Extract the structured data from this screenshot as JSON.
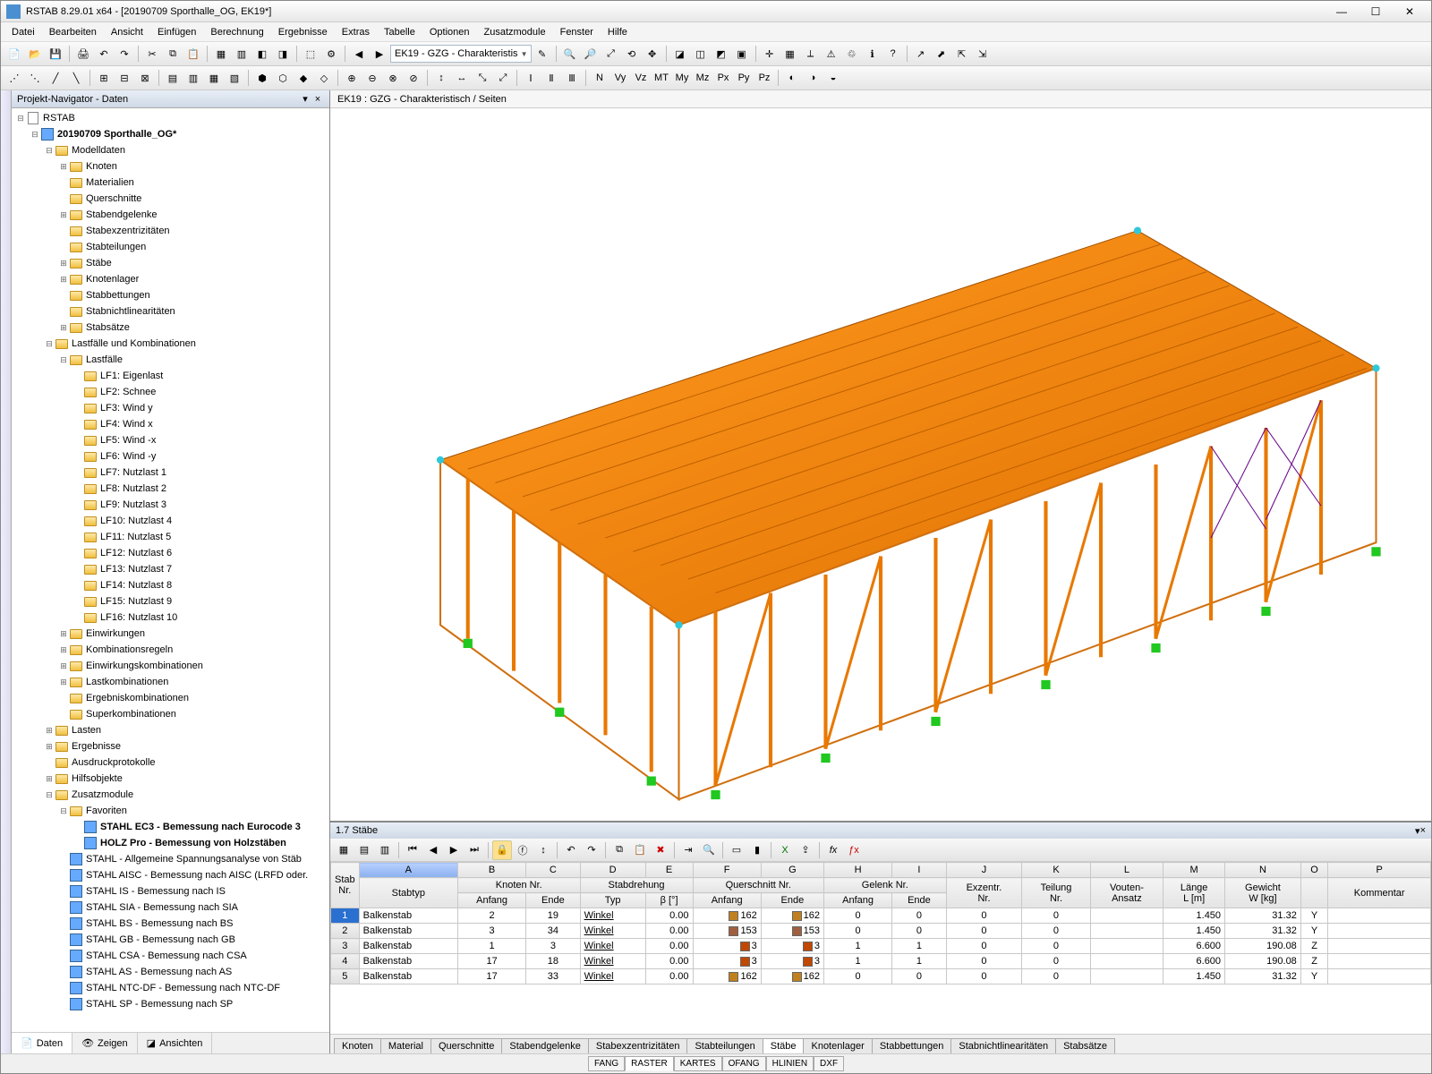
{
  "window": {
    "title": "RSTAB 8.29.01 x64 - [20190709 Sporthalle_OG, EK19*]",
    "min": "—",
    "max": "☐",
    "close": "✕"
  },
  "menu": [
    "Datei",
    "Bearbeiten",
    "Ansicht",
    "Einfügen",
    "Berechnung",
    "Ergebnisse",
    "Extras",
    "Tabelle",
    "Optionen",
    "Zusatzmodule",
    "Fenster",
    "Hilfe"
  ],
  "combo_view": "EK19 - GZG - Charakteristis",
  "navigator": {
    "title": "Projekt-Navigator - Daten",
    "root": "RSTAB",
    "project": "20190709 Sporthalle_OG*",
    "modelldaten": {
      "label": "Modelldaten",
      "items": [
        "Knoten",
        "Materialien",
        "Querschnitte",
        "Stabendgelenke",
        "Stabexzentrizitäten",
        "Stabteilungen",
        "Stäbe",
        "Knotenlager",
        "Stabbettungen",
        "Stabnichtlinearitäten",
        "Stabsätze"
      ]
    },
    "lastfaelle_group": {
      "label": "Lastfälle und Kombinationen",
      "lastfaelle": {
        "label": "Lastfälle",
        "items": [
          "LF1: Eigenlast",
          "LF2: Schnee",
          "LF3: Wind y",
          "LF4: Wind x",
          "LF5: Wind -x",
          "LF6: Wind -y",
          "LF7: Nutzlast 1",
          "LF8: Nutzlast 2",
          "LF9: Nutzlast 3",
          "LF10: Nutzlast 4",
          "LF11: Nutzlast 5",
          "LF12: Nutzlast 6",
          "LF13: Nutzlast 7",
          "LF14: Nutzlast 8",
          "LF15: Nutzlast 9",
          "LF16: Nutzlast 10"
        ]
      },
      "others": [
        "Einwirkungen",
        "Kombinationsregeln",
        "Einwirkungskombinationen",
        "Lastkombinationen",
        "Ergebniskombinationen",
        "Superkombinationen"
      ]
    },
    "lasten": "Lasten",
    "ergebnisse": "Ergebnisse",
    "ausdruck": "Ausdruckprotokolle",
    "hilfs": "Hilfsobjekte",
    "zusatz": {
      "label": "Zusatzmodule",
      "fav": "Favoriten",
      "fav_items": [
        "STAHL EC3 - Bemessung nach Eurocode 3",
        "HOLZ Pro - Bemessung von Holzstäben"
      ],
      "modules": [
        "STAHL - Allgemeine Spannungsanalyse von Stäb",
        "STAHL AISC - Bemessung nach AISC (LRFD oder.",
        "STAHL IS - Bemessung nach IS",
        "STAHL SIA - Bemessung nach SIA",
        "STAHL BS - Bemessung nach BS",
        "STAHL GB - Bemessung nach GB",
        "STAHL CSA - Bemessung nach CSA",
        "STAHL AS - Bemessung nach AS",
        "STAHL NTC-DF - Bemessung nach NTC-DF",
        "STAHL SP - Bemessung nach SP"
      ]
    },
    "tabs": [
      "Daten",
      "Zeigen",
      "Ansichten"
    ]
  },
  "view_tab": "EK19 : GZG - Charakteristisch / Seiten",
  "table": {
    "title": "1.7 Stäbe",
    "col_letters": [
      "A",
      "B",
      "C",
      "D",
      "E",
      "F",
      "G",
      "H",
      "I",
      "J",
      "K",
      "L",
      "M",
      "N",
      "O",
      "P"
    ],
    "group_headers": {
      "stabnr": "Stab\nNr.",
      "stabtyp": "Stabtyp",
      "knoten": "Knoten Nr.",
      "stabdreh": "Stabdrehung",
      "quer": "Querschnitt Nr.",
      "gelenk": "Gelenk Nr.",
      "exz": "Exzentr.\nNr.",
      "teil": "Teilung\nNr.",
      "vouten": "Vouten-\nAnsatz",
      "laenge": "Länge\nL [m]",
      "gewicht": "Gewicht\nW [kg]",
      "kommentar": "Kommentar"
    },
    "sub_headers": {
      "anfang": "Anfang",
      "ende": "Ende",
      "typ": "Typ",
      "beta": "β [°]"
    },
    "rows": [
      {
        "n": "1",
        "typ": "Balkenstab",
        "ka": "2",
        "ke": "19",
        "dtyp": "Winkel",
        "beta": "0.00",
        "qa": "162",
        "qe": "162",
        "ga": "0",
        "ge": "0",
        "ex": "0",
        "te": "0",
        "va": "",
        "L": "1.450",
        "W": "31.32",
        "ax": "Y",
        "km": ""
      },
      {
        "n": "2",
        "typ": "Balkenstab",
        "ka": "3",
        "ke": "34",
        "dtyp": "Winkel",
        "beta": "0.00",
        "qa": "153",
        "qe": "153",
        "ga": "0",
        "ge": "0",
        "ex": "0",
        "te": "0",
        "va": "",
        "L": "1.450",
        "W": "31.32",
        "ax": "Y",
        "km": ""
      },
      {
        "n": "3",
        "typ": "Balkenstab",
        "ka": "1",
        "ke": "3",
        "dtyp": "Winkel",
        "beta": "0.00",
        "qa": "3",
        "qe": "3",
        "ga": "1",
        "ge": "1",
        "ex": "0",
        "te": "0",
        "va": "",
        "L": "6.600",
        "W": "190.08",
        "ax": "Z",
        "km": ""
      },
      {
        "n": "4",
        "typ": "Balkenstab",
        "ka": "17",
        "ke": "18",
        "dtyp": "Winkel",
        "beta": "0.00",
        "qa": "3",
        "qe": "3",
        "ga": "1",
        "ge": "1",
        "ex": "0",
        "te": "0",
        "va": "",
        "L": "6.600",
        "W": "190.08",
        "ax": "Z",
        "km": ""
      },
      {
        "n": "5",
        "typ": "Balkenstab",
        "ka": "17",
        "ke": "33",
        "dtyp": "Winkel",
        "beta": "0.00",
        "qa": "162",
        "qe": "162",
        "ga": "0",
        "ge": "0",
        "ex": "0",
        "te": "0",
        "va": "",
        "L": "1.450",
        "W": "31.32",
        "ax": "Y",
        "km": ""
      }
    ],
    "tabs": [
      "Knoten",
      "Material",
      "Querschnitte",
      "Stabendgelenke",
      "Stabexzentrizitäten",
      "Stabteilungen",
      "Stäbe",
      "Knotenlager",
      "Stabbettungen",
      "Stabnichtlinearitäten",
      "Stabsätze"
    ],
    "active_tab": 6
  },
  "status": [
    "FANG",
    "RASTER",
    "KARTES",
    "OFANG",
    "HLINIEN",
    "DXF"
  ]
}
